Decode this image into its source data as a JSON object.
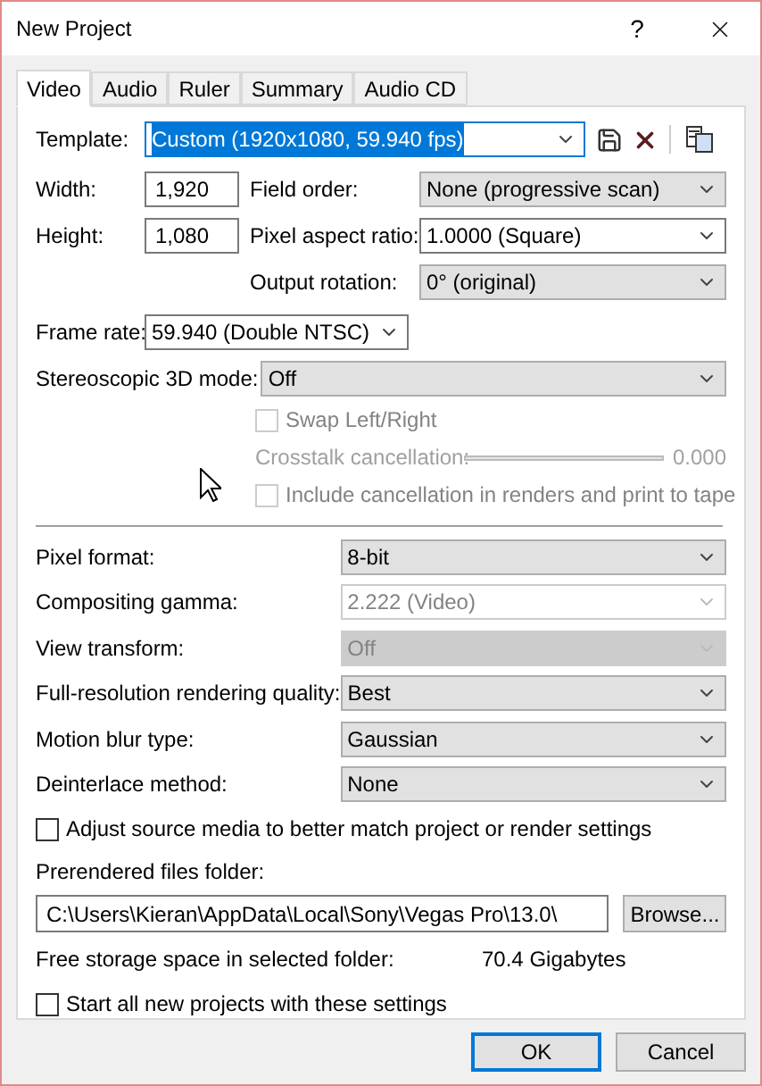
{
  "window": {
    "title": "New Project",
    "help": "?"
  },
  "tabs": [
    {
      "label": "Video",
      "selected": true
    },
    {
      "label": "Audio",
      "selected": false
    },
    {
      "label": "Ruler",
      "selected": false
    },
    {
      "label": "Summary",
      "selected": false
    },
    {
      "label": "Audio CD",
      "selected": false
    }
  ],
  "template": {
    "label": "Template:",
    "value": "Custom (1920x1080, 59.940 fps)"
  },
  "width": {
    "label": "Width:",
    "value": "1,920"
  },
  "height": {
    "label": "Height:",
    "value": "1,080"
  },
  "field_order": {
    "label": "Field order:",
    "value": "None (progressive scan)",
    "kind": "list",
    "disabled": false
  },
  "pixel_aspect_ratio": {
    "label": "Pixel aspect ratio:",
    "value": "1.0000 (Square)",
    "kind": "editable",
    "disabled": false
  },
  "output_rotation": {
    "label": "Output rotation:",
    "value": "0° (original)",
    "kind": "list",
    "disabled": false
  },
  "frame_rate": {
    "label": "Frame rate:",
    "value": "59.940 (Double NTSC)"
  },
  "stereoscopic_mode": {
    "label": "Stereoscopic 3D mode:",
    "value": "Off",
    "kind": "list",
    "disabled": false
  },
  "swap_left_right": {
    "label": "Swap Left/Right",
    "checked": false,
    "disabled": true
  },
  "crosstalk": {
    "label": "Crosstalk cancellation:",
    "value": "0.000",
    "disabled": true
  },
  "include_cancellation": {
    "label": "Include cancellation in renders and print to tape",
    "checked": false,
    "disabled": true
  },
  "settings": [
    {
      "label": "Pixel format:",
      "value": "8-bit",
      "kind": "list",
      "disabled": false
    },
    {
      "label": "Compositing gamma:",
      "value": "2.222 (Video)",
      "kind": "editable",
      "disabled": true
    },
    {
      "label": "View transform:",
      "value": "Off",
      "kind": "list",
      "disabled": true
    },
    {
      "label": "Full-resolution rendering quality:",
      "value": "Best",
      "kind": "list",
      "disabled": false
    },
    {
      "label": "Motion blur type:",
      "value": "Gaussian",
      "kind": "list",
      "disabled": false
    },
    {
      "label": "Deinterlace method:",
      "value": "None",
      "kind": "list",
      "disabled": false
    }
  ],
  "adjust_source": {
    "label": "Adjust source media to better match project or render settings",
    "checked": false
  },
  "prerendered": {
    "label": "Prerendered files folder:",
    "path": "C:\\Users\\Kieran\\AppData\\Local\\Sony\\Vegas Pro\\13.0\\",
    "browse": "Browse..."
  },
  "free_storage": {
    "label": "Free storage space in selected folder:",
    "value": "70.4 Gigabytes"
  },
  "start_all": {
    "label": "Start all new projects with these settings",
    "checked": false
  },
  "buttons": [
    {
      "label": "OK",
      "default": true
    },
    {
      "label": "Cancel",
      "default": false
    }
  ]
}
